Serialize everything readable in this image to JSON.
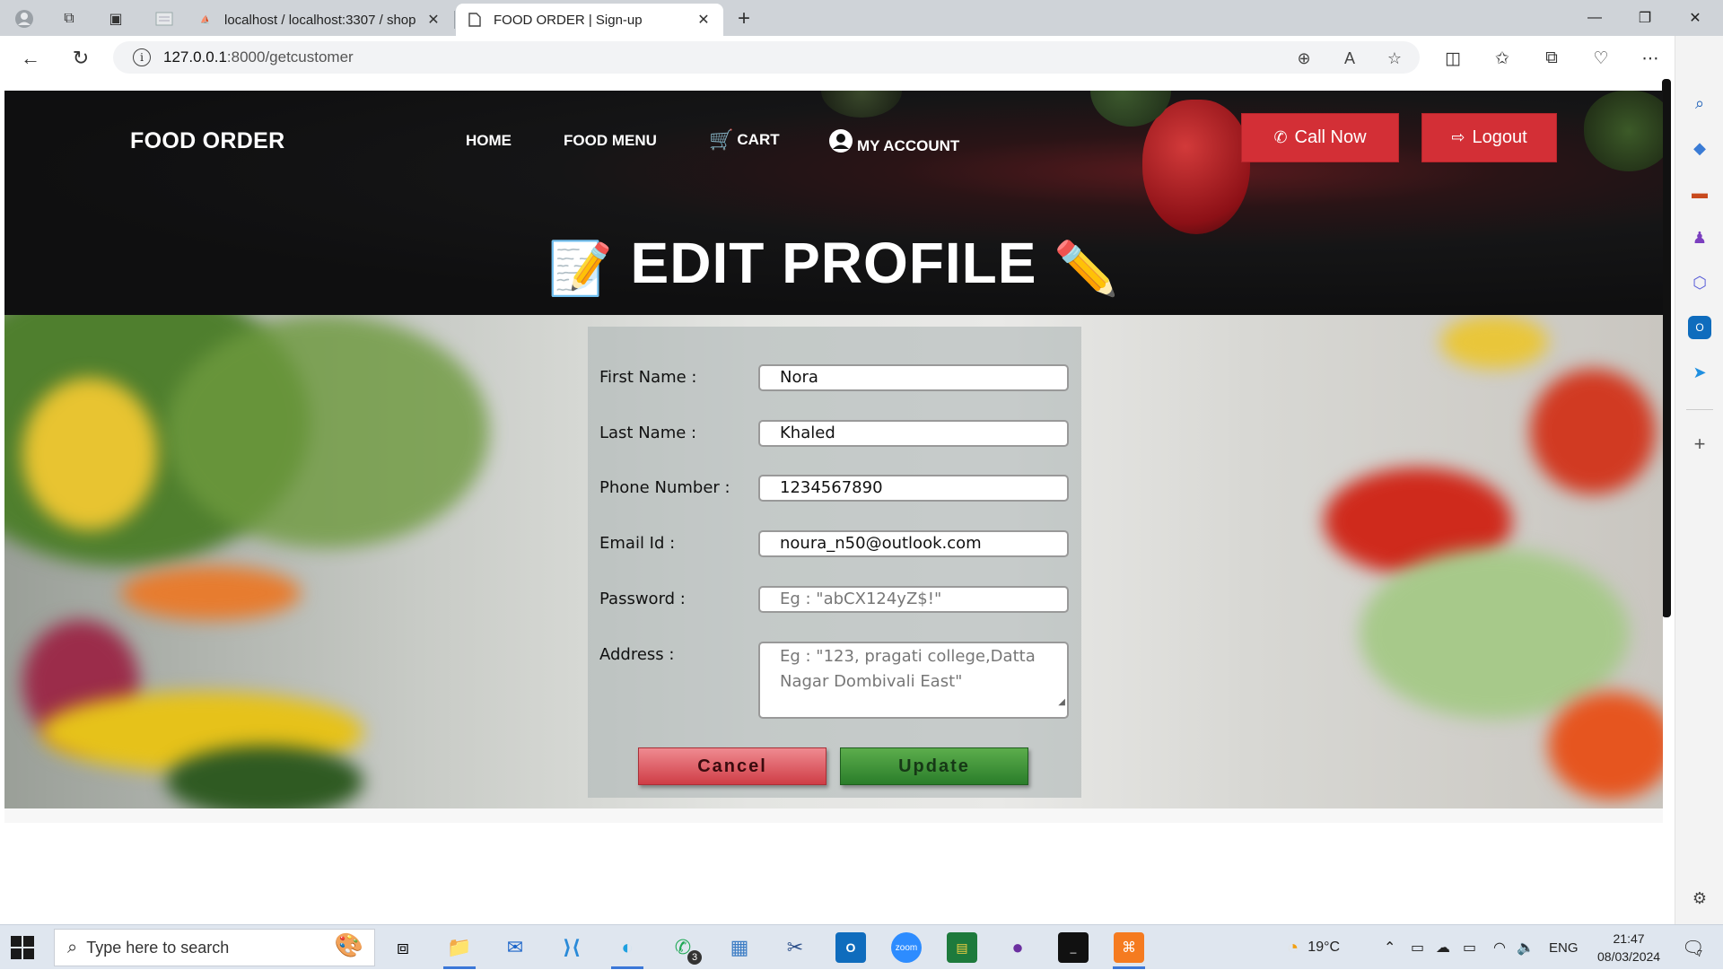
{
  "browser": {
    "tabs": [
      {
        "title": "localhost / localhost:3307 / shop",
        "favicon": "PMA",
        "active": false
      },
      {
        "title": "FOOD ORDER | Sign-up",
        "active": true
      }
    ],
    "url_host": "127.0.0.1",
    "url_path": ":8000/getcustomer"
  },
  "nav": {
    "brand": "FOOD ORDER",
    "home": "HOME",
    "food_menu": "FOOD MENU",
    "cart": "CART",
    "account": "MY ACCOUNT",
    "call_now": "Call Now",
    "logout": "Logout"
  },
  "page": {
    "title": "EDIT PROFILE"
  },
  "form": {
    "first_name_label": "First Name :",
    "first_name_value": "Nora",
    "last_name_label": "Last Name :",
    "last_name_value": "Khaled",
    "phone_label": "Phone Number :",
    "phone_value": "1234567890",
    "email_label": "Email Id :",
    "email_value": "noura_n50@outlook.com",
    "password_label": "Password :",
    "password_placeholder": "Eg : \"abCX124yZ$!\"",
    "address_label": "Address :",
    "address_placeholder": "Eg : \"123, pragati college,Datta Nagar Dombivali East\"",
    "cancel": "Cancel",
    "update": "Update"
  },
  "taskbar": {
    "search_placeholder": "Type here to search",
    "weather": "19°C",
    "language": "ENG",
    "time": "21:47",
    "date": "08/03/2024",
    "whatsapp_badge": "3",
    "notification_badge": "7"
  },
  "colors": {
    "accent_red": "#d32f36",
    "update_green": "#2a7d2a",
    "cancel_red": "#cf3d46"
  }
}
